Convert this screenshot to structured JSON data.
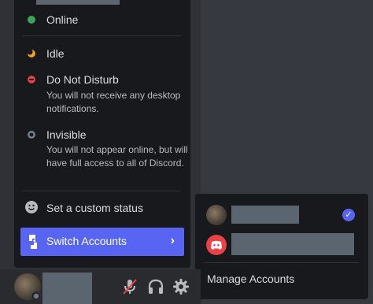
{
  "status_menu": {
    "items": [
      {
        "label": "Online",
        "color": "#3ba55d"
      },
      {
        "label": "Idle",
        "color": "#faa81a"
      },
      {
        "label": "Do Not Disturb",
        "desc": "You will not receive any desktop notifications.",
        "color": "#ed4245"
      },
      {
        "label": "Invisible",
        "desc": "You will not appear online, but will have full access to all of Discord.",
        "color": "#747f8d"
      }
    ],
    "custom_status": "Set a custom status",
    "switch_accounts": "Switch Accounts"
  },
  "accounts": {
    "manage_label": "Manage Accounts",
    "accent": "#5865f2"
  },
  "icons": [
    "smile-icon",
    "switch-icon",
    "chevron-right-icon",
    "check-icon",
    "discord-icon",
    "mute-mic-icon",
    "headphones-icon",
    "gear-icon"
  ]
}
